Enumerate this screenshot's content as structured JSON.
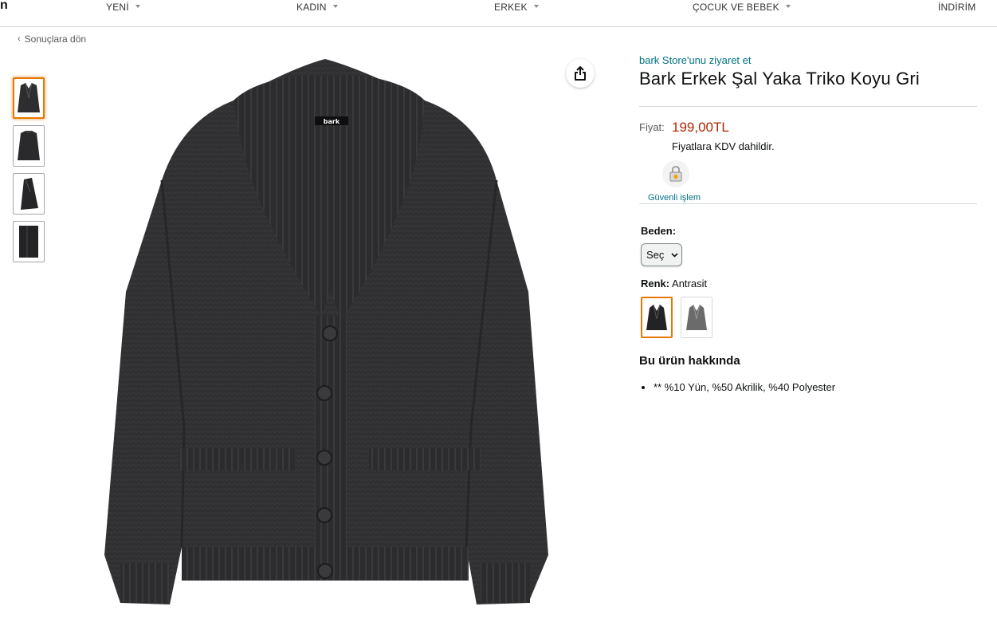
{
  "nav": {
    "logo_fragment": "n",
    "items": [
      {
        "label": "YENİ",
        "dropdown": true
      },
      {
        "label": "KADIN",
        "dropdown": true
      },
      {
        "label": "ERKEK",
        "dropdown": true
      },
      {
        "label": "ÇOCUK VE BEBEK",
        "dropdown": true
      },
      {
        "label": "İNDİRİM",
        "dropdown": false
      }
    ]
  },
  "back_link": "Sonuçlara dön",
  "gallery": {
    "thumbnails": [
      "front-view",
      "back-view",
      "side-view",
      "detail-view"
    ],
    "selected_index": 0,
    "share_icon": "share-icon"
  },
  "product": {
    "store_link": "bark Store'unu ziyaret et",
    "title": "Bark Erkek Şal Yaka Triko Koyu Gri",
    "price_label": "Fiyat:",
    "price": "199,00TL",
    "vat_note": "Fiyatlara KDV dahildir.",
    "secure_label": "Güvenli işlem",
    "size_label": "Beden:",
    "size_selected": "Seç",
    "color_label": "Renk:",
    "color_value": "Antrasit",
    "color_options": [
      "Antrasit",
      "Gri"
    ],
    "about_title": "Bu ürün hakkında",
    "bullets": [
      "** %10 Yün, %50 Akrilik, %40 Polyester"
    ]
  },
  "colors": {
    "link": "#007185",
    "price": "#b12704",
    "selected_border": "#e77600",
    "sweater_dark": "#2e2e30",
    "sweater_gray": "#6b6b6b"
  }
}
